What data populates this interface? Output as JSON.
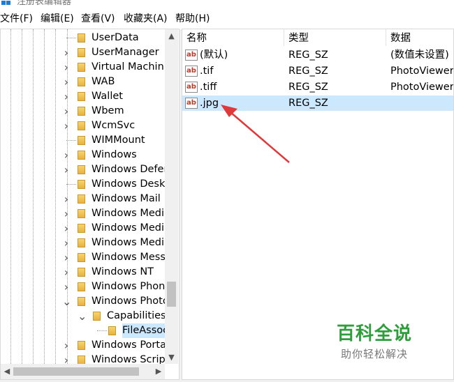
{
  "window": {
    "title": "注册表编辑器"
  },
  "menu": [
    "文件(F)",
    "编辑(E)",
    "查看(V)",
    "收藏夹(A)",
    "帮助(H)"
  ],
  "tree": {
    "items": [
      {
        "label": "UserData",
        "expander": ""
      },
      {
        "label": "UserManager",
        "expander": ">"
      },
      {
        "label": "Virtual Machin",
        "expander": ">"
      },
      {
        "label": "WAB",
        "expander": ">"
      },
      {
        "label": "Wallet",
        "expander": ">"
      },
      {
        "label": "Wbem",
        "expander": ">"
      },
      {
        "label": "WcmSvc",
        "expander": ">"
      },
      {
        "label": "WIMMount",
        "expander": ""
      },
      {
        "label": "Windows",
        "expander": ">"
      },
      {
        "label": "Windows Defer",
        "expander": ">"
      },
      {
        "label": "Windows Desk",
        "expander": ""
      },
      {
        "label": "Windows Mail",
        "expander": ">"
      },
      {
        "label": "Windows Medi",
        "expander": ">"
      },
      {
        "label": "Windows Medi",
        "expander": ">"
      },
      {
        "label": "Windows Medi",
        "expander": ">"
      },
      {
        "label": "Windows Mess",
        "expander": ">"
      },
      {
        "label": "Windows NT",
        "expander": ">"
      },
      {
        "label": "Windows Phon",
        "expander": ">"
      },
      {
        "label": "Windows Photo",
        "expander": "v"
      },
      {
        "label": "Capabilities",
        "expander": "v"
      },
      {
        "label": "FileAssoc",
        "expander": ""
      },
      {
        "label": "Windows Porta",
        "expander": ">"
      },
      {
        "label": "Windows Scrip",
        "expander": ">"
      }
    ]
  },
  "list": {
    "columns": [
      "名称",
      "类型",
      "数据"
    ],
    "rows": [
      {
        "icon": "ab",
        "name": "(默认)",
        "type": "REG_SZ",
        "data": "(数值未设置)"
      },
      {
        "icon": "ab",
        "name": ".tif",
        "type": "REG_SZ",
        "data": "PhotoViewer."
      },
      {
        "icon": "ab",
        "name": ".tiff",
        "type": "REG_SZ",
        "data": "PhotoViewer."
      },
      {
        "icon": "ab",
        "name": ".jpg",
        "type": "REG_SZ",
        "data": ""
      }
    ]
  },
  "watermark": {
    "title": "百科全说",
    "subtitle": "助你轻松解决"
  },
  "colors": {
    "selection": "#cce8ff",
    "arrow": "#e0393c",
    "watermark": "#2e9e3a"
  }
}
